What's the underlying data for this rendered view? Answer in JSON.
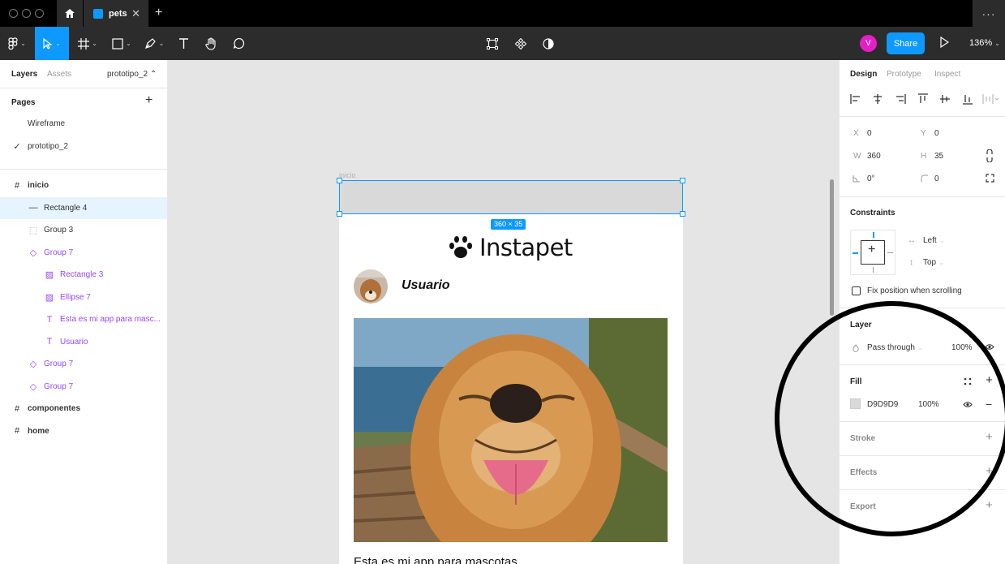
{
  "titlebar": {
    "tab_name": "pets",
    "close": "✕",
    "plus": "+",
    "more": "···"
  },
  "toolbar": {
    "avatar_initial": "V",
    "share_label": "Share",
    "zoom": "136%"
  },
  "left_panel": {
    "tabs": [
      "Layers",
      "Assets"
    ],
    "page_selector": "prototipo_2 ⌃",
    "pages_title": "Pages",
    "pages": [
      {
        "label": "Wireframe",
        "checked": false
      },
      {
        "label": "prototipo_2",
        "checked": true
      }
    ],
    "layers": [
      {
        "label": "inicio",
        "icon": "#",
        "indent": 0,
        "style": "frame"
      },
      {
        "label": "Rectangle 4",
        "icon": "—",
        "indent": 1,
        "style": "selected"
      },
      {
        "label": "Group 3",
        "icon": "⬚",
        "indent": 1,
        "style": "normal"
      },
      {
        "label": "Group 7",
        "icon": "◇",
        "indent": 1,
        "style": "component"
      },
      {
        "label": "Rectangle 3",
        "icon": "▨",
        "indent": 2,
        "style": "component"
      },
      {
        "label": "Ellipse 7",
        "icon": "▨",
        "indent": 2,
        "style": "component"
      },
      {
        "label": "Esta es mi app para masc...",
        "icon": "T",
        "indent": 2,
        "style": "component"
      },
      {
        "label": "Usuario",
        "icon": "T",
        "indent": 2,
        "style": "component"
      },
      {
        "label": "Group 7",
        "icon": "◇",
        "indent": 1,
        "style": "component"
      },
      {
        "label": "Group 7",
        "icon": "◇",
        "indent": 1,
        "style": "component"
      },
      {
        "label": "componentes",
        "icon": "#",
        "indent": 0,
        "style": "frame"
      },
      {
        "label": "home",
        "icon": "#",
        "indent": 0,
        "style": "frame"
      }
    ]
  },
  "canvas": {
    "frame_label": "inicio",
    "dimension_tag": "360 × 35",
    "logo_text": "Instapet",
    "username": "Usuario",
    "caption": "Esta es mi app para mascotas"
  },
  "right_panel": {
    "tabs": [
      "Design",
      "Prototype",
      "Inspect"
    ],
    "x_label": "X",
    "x_value": "0",
    "y_label": "Y",
    "y_value": "0",
    "w_label": "W",
    "w_value": "360",
    "h_label": "H",
    "h_value": "35",
    "rotation": "0°",
    "radius": "0",
    "constraints_title": "Constraints",
    "constraint_h": "Left",
    "constraint_v": "Top",
    "fix_position": "Fix position when scrolling",
    "layer_title": "Layer",
    "blend_mode": "Pass through",
    "layer_opacity": "100%",
    "fill_title": "Fill",
    "fill_hex": "D9D9D9",
    "fill_opacity": "100%",
    "stroke_title": "Stroke",
    "effects_title": "Effects",
    "export_title": "Export"
  },
  "colors": {
    "accent": "#0d99ff",
    "fill": "#d9d9d9",
    "component": "#9747ff",
    "avatar": "#e51ec6"
  }
}
